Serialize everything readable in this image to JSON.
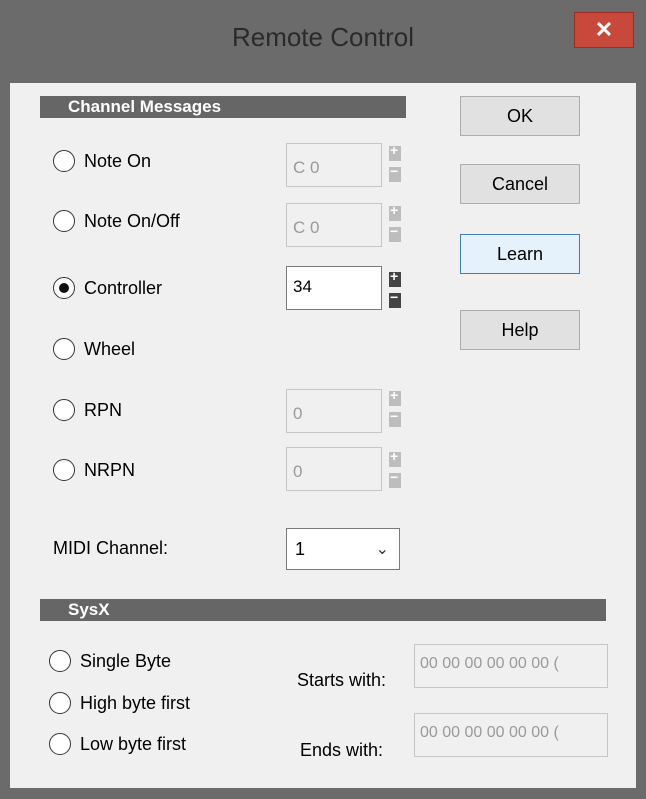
{
  "window": {
    "title": "Remote Control",
    "close_glyph": "✕"
  },
  "channel_messages": {
    "header": "Channel Messages",
    "options": [
      {
        "label": "Note On",
        "selected": false,
        "value": "C 0",
        "enabled": false
      },
      {
        "label": "Note On/Off",
        "selected": false,
        "value": "C 0",
        "enabled": false
      },
      {
        "label": "Controller",
        "selected": true,
        "value": "34",
        "enabled": true
      },
      {
        "label": "Wheel",
        "selected": false
      },
      {
        "label": "RPN",
        "selected": false,
        "value": "0",
        "enabled": false
      },
      {
        "label": "NRPN",
        "selected": false,
        "value": "0",
        "enabled": false
      }
    ],
    "midi_channel_label": "MIDI Channel:",
    "midi_channel_value": "1"
  },
  "buttons": {
    "ok": "OK",
    "cancel": "Cancel",
    "learn": "Learn",
    "help": "Help"
  },
  "sysx": {
    "header": "SysX",
    "options": [
      {
        "label": "Single Byte",
        "selected": false
      },
      {
        "label": "High byte first",
        "selected": false
      },
      {
        "label": "Low byte first",
        "selected": false
      }
    ],
    "starts_label": "Starts with:",
    "starts_value": "00 00 00 00 00 00 (",
    "ends_label": "Ends with:",
    "ends_value": "00 00 00 00 00 00 ("
  },
  "icons": {
    "close": "close-icon",
    "dropdown": "chevron-down-icon"
  },
  "colors": {
    "section_bg": "#666666",
    "close_bg": "#c9483c",
    "focus_border": "#3c7fb1"
  }
}
